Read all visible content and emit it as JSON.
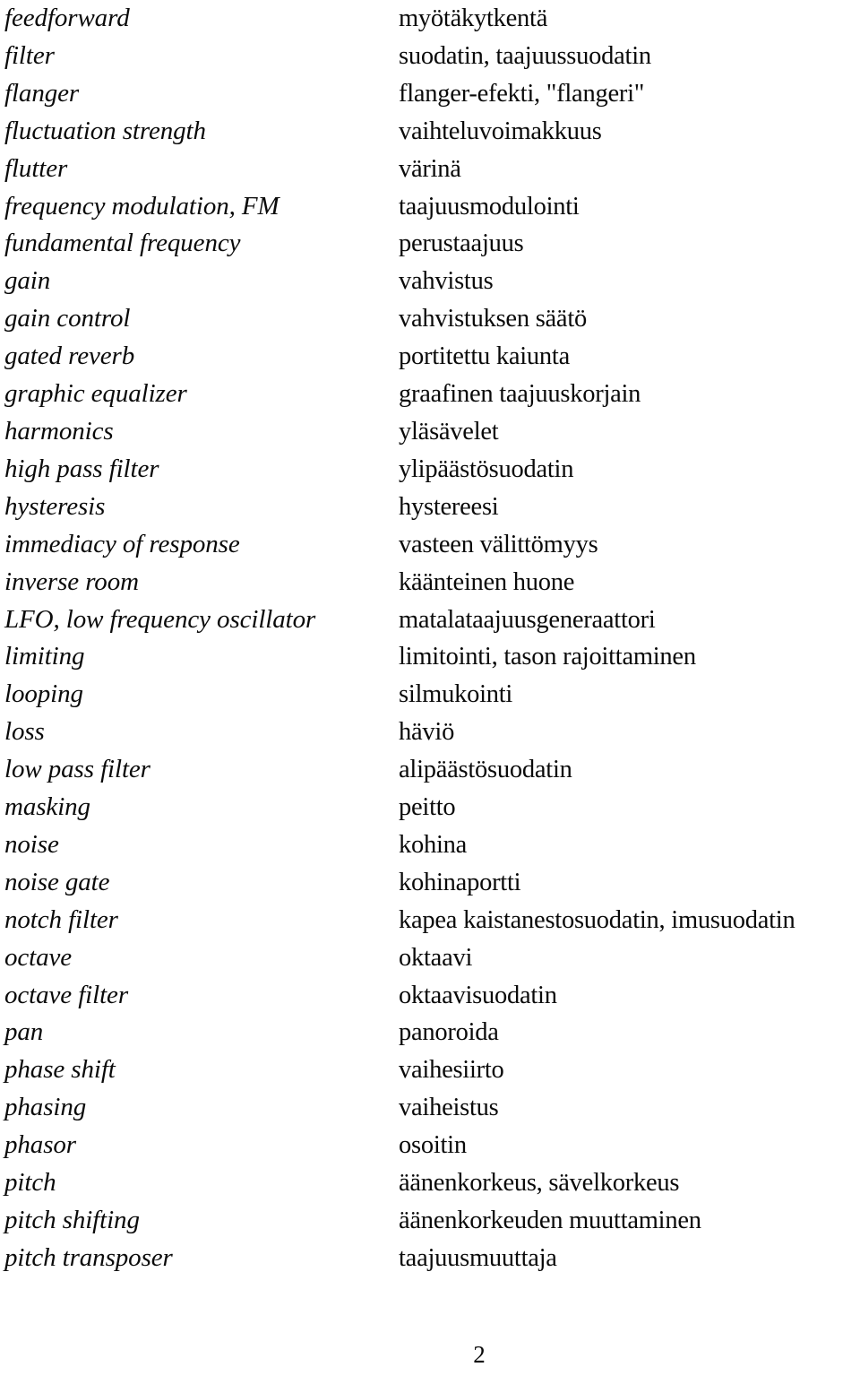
{
  "document": {
    "page_number": "2",
    "columns": {
      "term_language": "english",
      "translation_language": "finnish"
    }
  },
  "entries": [
    {
      "term": "feedforward",
      "translation": "myötäkytkentä"
    },
    {
      "term": "filter",
      "translation": "suodatin, taajuussuodatin"
    },
    {
      "term": "flanger",
      "translation": "flanger-efekti, \"flangeri\""
    },
    {
      "term": "fluctuation strength",
      "translation": "vaihteluvoimakkuus"
    },
    {
      "term": "flutter",
      "translation": "värinä"
    },
    {
      "term": "frequency modulation, FM",
      "translation": "taajuusmodulointi"
    },
    {
      "term": "fundamental frequency",
      "translation": "perustaajuus"
    },
    {
      "term": "gain",
      "translation": "vahvistus"
    },
    {
      "term": "gain control",
      "translation": "vahvistuksen säätö"
    },
    {
      "term": "gated reverb",
      "translation": "portitettu kaiunta"
    },
    {
      "term": "graphic equalizer",
      "translation": "graafinen taajuuskorjain"
    },
    {
      "term": "harmonics",
      "translation": "yläsävelet"
    },
    {
      "term": "high pass filter",
      "translation": "ylipäästösuodatin"
    },
    {
      "term": "hysteresis",
      "translation": "hystereesi"
    },
    {
      "term": "immediacy of response",
      "translation": "vasteen välittömyys"
    },
    {
      "term": "inverse room",
      "translation": "käänteinen huone"
    },
    {
      "term": "LFO, low frequency oscillator",
      "translation": "matalataajuusgeneraattori"
    },
    {
      "term": "limiting",
      "translation": "limitointi, tason rajoittaminen"
    },
    {
      "term": "looping",
      "translation": "silmukointi"
    },
    {
      "term": "loss",
      "translation": "häviö"
    },
    {
      "term": "low pass filter",
      "translation": "alipäästösuodatin"
    },
    {
      "term": "masking",
      "translation": "peitto"
    },
    {
      "term": "noise",
      "translation": "kohina"
    },
    {
      "term": "noise gate",
      "translation": "kohinaportti"
    },
    {
      "term": "notch filter",
      "translation": "kapea kaistanestosuodatin, imusuodatin"
    },
    {
      "term": "octave",
      "translation": "oktaavi"
    },
    {
      "term": "octave filter",
      "translation": "oktaavisuodatin"
    },
    {
      "term": "pan",
      "translation": "panoroida"
    },
    {
      "term": "phase shift",
      "translation": "vaihesiirto"
    },
    {
      "term": "phasing",
      "translation": "vaiheistus"
    },
    {
      "term": "phasor",
      "translation": "osoitin"
    },
    {
      "term": "pitch",
      "translation": "äänenkorkeus, sävelkorkeus"
    },
    {
      "term": "pitch shifting",
      "translation": "äänenkorkeuden muuttaminen"
    },
    {
      "term": "pitch transposer",
      "translation": "taajuusmuuttaja"
    }
  ]
}
